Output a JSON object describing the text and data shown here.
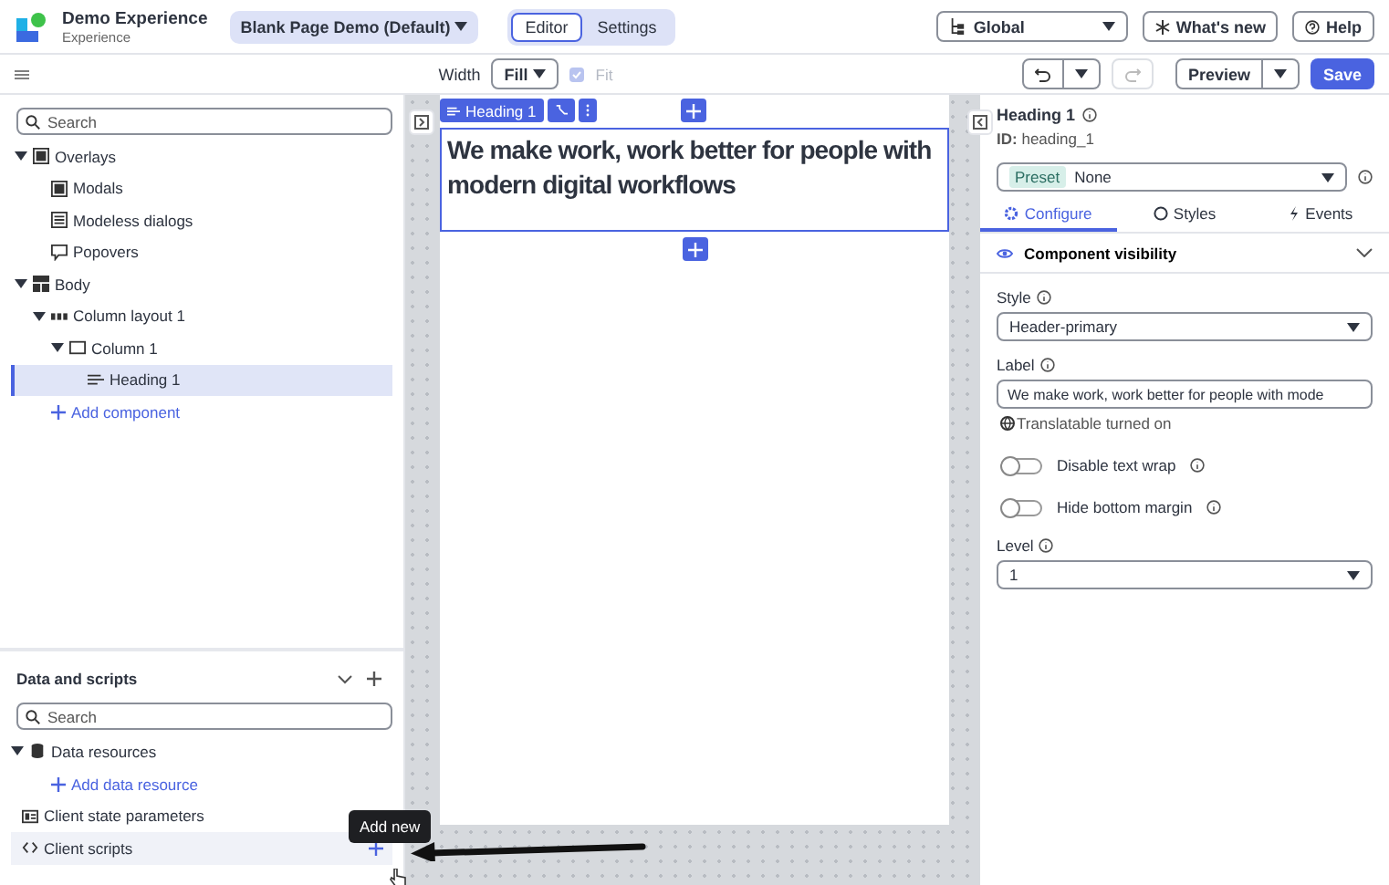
{
  "app": {
    "title": "Demo Experience",
    "subtitle": "Experience"
  },
  "page_selector": "Blank Page Demo (Default)",
  "mode_tabs": [
    {
      "label": "Editor",
      "selected": true
    },
    {
      "label": "Settings",
      "selected": false
    }
  ],
  "scope_select": "Global",
  "whats_new": "What's new",
  "help": "Help",
  "toolbar": {
    "width_label": "Width",
    "width_value": "Fill",
    "fit": {
      "label": "Fit",
      "checked": true,
      "disabled": true
    },
    "preview": "Preview",
    "save": "Save"
  },
  "outline": {
    "search_placeholder": "Search",
    "add_component": "Add component",
    "tree": [
      {
        "label": "Overlays",
        "kind": "overlays",
        "expanded": true,
        "selected": false,
        "children": [
          {
            "label": "Modals",
            "kind": "modal",
            "selected": false
          },
          {
            "label": "Modeless dialogs",
            "kind": "dialog",
            "selected": false
          },
          {
            "label": "Popovers",
            "kind": "popover",
            "selected": false
          }
        ]
      },
      {
        "label": "Body",
        "kind": "body",
        "expanded": true,
        "selected": false,
        "children": [
          {
            "label": "Column layout 1",
            "kind": "columns",
            "expanded": true,
            "selected": false,
            "children": [
              {
                "label": "Column 1",
                "kind": "column",
                "expanded": true,
                "selected": false,
                "children": [
                  {
                    "label": "Heading 1",
                    "kind": "heading",
                    "selected": true
                  }
                ]
              }
            ]
          }
        ]
      }
    ]
  },
  "data_scripts": {
    "title": "Data and scripts",
    "search_placeholder": "Search",
    "items": [
      {
        "label": "Data resources",
        "kind": "database",
        "expanded": true,
        "hovered": false,
        "add_link": "Add data resource"
      },
      {
        "label": "Client state parameters",
        "kind": "parameters",
        "hovered": false
      },
      {
        "label": "Client scripts",
        "kind": "scripts",
        "hovered": true
      }
    ]
  },
  "tooltip": "Add new",
  "canvas": {
    "chip": "Heading 1",
    "heading": "We make work, work better for people with modern digital workflows"
  },
  "properties": {
    "title": "Heading 1",
    "id_label": "ID:",
    "id": "heading_1",
    "preset_badge": "Preset",
    "preset_value": "None",
    "tabs": [
      {
        "label": "Configure",
        "selected": true
      },
      {
        "label": "Styles",
        "selected": false
      },
      {
        "label": "Events",
        "selected": false
      }
    ],
    "section": "Component visibility",
    "style": {
      "label": "Style",
      "value": "Header-primary"
    },
    "label_field": {
      "label": "Label",
      "value": "We make work, work better for people with mode"
    },
    "translatable": "Translatable turned on",
    "toggles": [
      {
        "label": "Disable text wrap",
        "on": false
      },
      {
        "label": "Hide bottom margin",
        "on": false
      }
    ],
    "level": {
      "label": "Level",
      "value": "1"
    }
  }
}
